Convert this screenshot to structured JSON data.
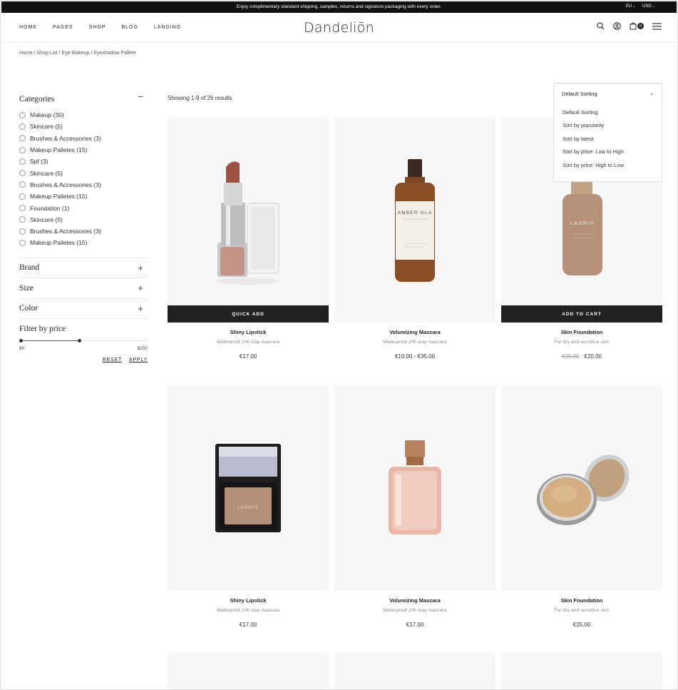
{
  "announcement": {
    "message": "Enjoy complimentary standard shipping, samples, returns and signature packaging with every order.",
    "region": "EU",
    "currency": "USD"
  },
  "nav": {
    "items": [
      "HOME",
      "PAGES",
      "SHOP",
      "BLOG",
      "LANDING"
    ]
  },
  "brand": {
    "logo": "Dandeliōn"
  },
  "header_icons": {
    "search": "search-icon",
    "account": "user-icon",
    "cart": "bag-icon",
    "menu": "hamburger-icon",
    "cart_count": "0"
  },
  "breadcrumb": "Home / Shop List / Eye Makeup / Eyeshadow Pallete",
  "sidebar": {
    "categories_title": "Categories",
    "categories": [
      "Makeup (30)",
      "Skincare (5)",
      "Brushes & Accessories (3)",
      "Makeup Palletes (15)",
      "Spf (3)",
      "Skincare (5)",
      "Brushes & Accessories (3)",
      "Makeup Palletes (15)",
      "Foundation (1)",
      "Skincare (5)",
      "Brushes & Accessories (3)",
      "Makeup Palletes (15)"
    ],
    "facets": [
      "Brand",
      "Size",
      "Color"
    ],
    "price_title": "Filter by price",
    "price_min": "$0",
    "price_max": "$250",
    "reset": "RESET",
    "apply": "APPLY"
  },
  "listing": {
    "results": "Showing 1-9 of 26 results",
    "sort_selected": "Default Sorting",
    "sort_options": [
      "Default Sorting",
      "Sort by popularity",
      "Sort by latest",
      "Sort by price: Low to High",
      "Sort by price: High to Low"
    ]
  },
  "products": [
    {
      "name": "Shiny Lipstick",
      "desc": "Waterproof 24h stay mascara",
      "price": "€17.00",
      "old_price": "",
      "button": "QUICK ADD",
      "label": ""
    },
    {
      "name": "Volumizing Mascara",
      "desc": "Waterproof 24h stay mascara",
      "price": "€10.00 - €35.00",
      "old_price": "",
      "button": "",
      "label": "AMBER GLA"
    },
    {
      "name": "Skin Foundation",
      "desc": "For dry and sensitive skin",
      "price": "€20.00",
      "old_price": "€25.00",
      "button": "ADD TO CART",
      "label": "LAORIV"
    },
    {
      "name": "Shiny Lipstick",
      "desc": "Waterproof 24h stay mascara",
      "price": "€17.00",
      "old_price": "",
      "button": "",
      "label": "LAORIV"
    },
    {
      "name": "Volumizing Mascara",
      "desc": "Waterproof 24h stay mascara",
      "price": "€17.00",
      "old_price": "",
      "button": "",
      "label": ""
    },
    {
      "name": "Skin Foundation",
      "desc": "For dry and sensitive skin",
      "price": "€25.00",
      "old_price": "",
      "button": "",
      "label": ""
    }
  ]
}
